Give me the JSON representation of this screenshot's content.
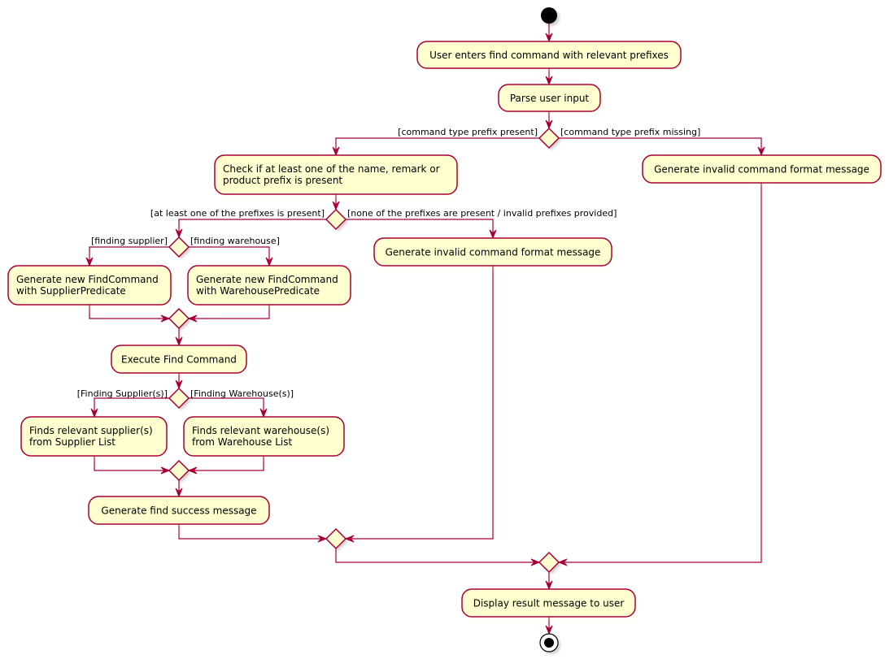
{
  "diagram": {
    "type": "activity",
    "colors": {
      "node_fill": "#FEFECE",
      "node_stroke": "#A80036",
      "edge": "#A80036",
      "start": "#000000"
    },
    "nodes": {
      "user_enters": {
        "lines": [
          "User enters find command with relevant prefixes"
        ]
      },
      "parse_input": {
        "lines": [
          "Parse user input"
        ]
      },
      "check_prefix": {
        "lines": [
          "Check if at least one of the name, remark or",
          "product prefix is present"
        ]
      },
      "invalid_format_right": {
        "lines": [
          "Generate invalid command format message"
        ]
      },
      "invalid_format_mid": {
        "lines": [
          "Generate invalid command format message"
        ]
      },
      "new_find_supplier": {
        "lines": [
          "Generate new FindCommand",
          "with SupplierPredicate"
        ]
      },
      "new_find_warehouse": {
        "lines": [
          "Generate new FindCommand",
          "with WarehousePredicate"
        ]
      },
      "execute_find": {
        "lines": [
          "Execute Find Command"
        ]
      },
      "finds_supplier": {
        "lines": [
          "Finds relevant supplier(s)",
          "from Supplier List"
        ]
      },
      "finds_warehouse": {
        "lines": [
          "Finds relevant warehouse(s)",
          "from Warehouse List"
        ]
      },
      "success_message": {
        "lines": [
          "Generate find success message"
        ]
      },
      "display_result": {
        "lines": [
          "Display result message to user"
        ]
      }
    },
    "guards": {
      "cmd_present": "[command type prefix present]",
      "cmd_missing": "[command type prefix missing]",
      "prefix_present": "[at least one of the prefixes is present]",
      "prefix_none": "[none of the prefixes are present / invalid prefixes provided]",
      "finding_supplier": "[finding supplier]",
      "finding_warehouse": "[finding warehouse]",
      "finding_suppliers": "[Finding Supplier(s)]",
      "finding_warehouses": "[Finding Warehouse(s)]"
    }
  }
}
